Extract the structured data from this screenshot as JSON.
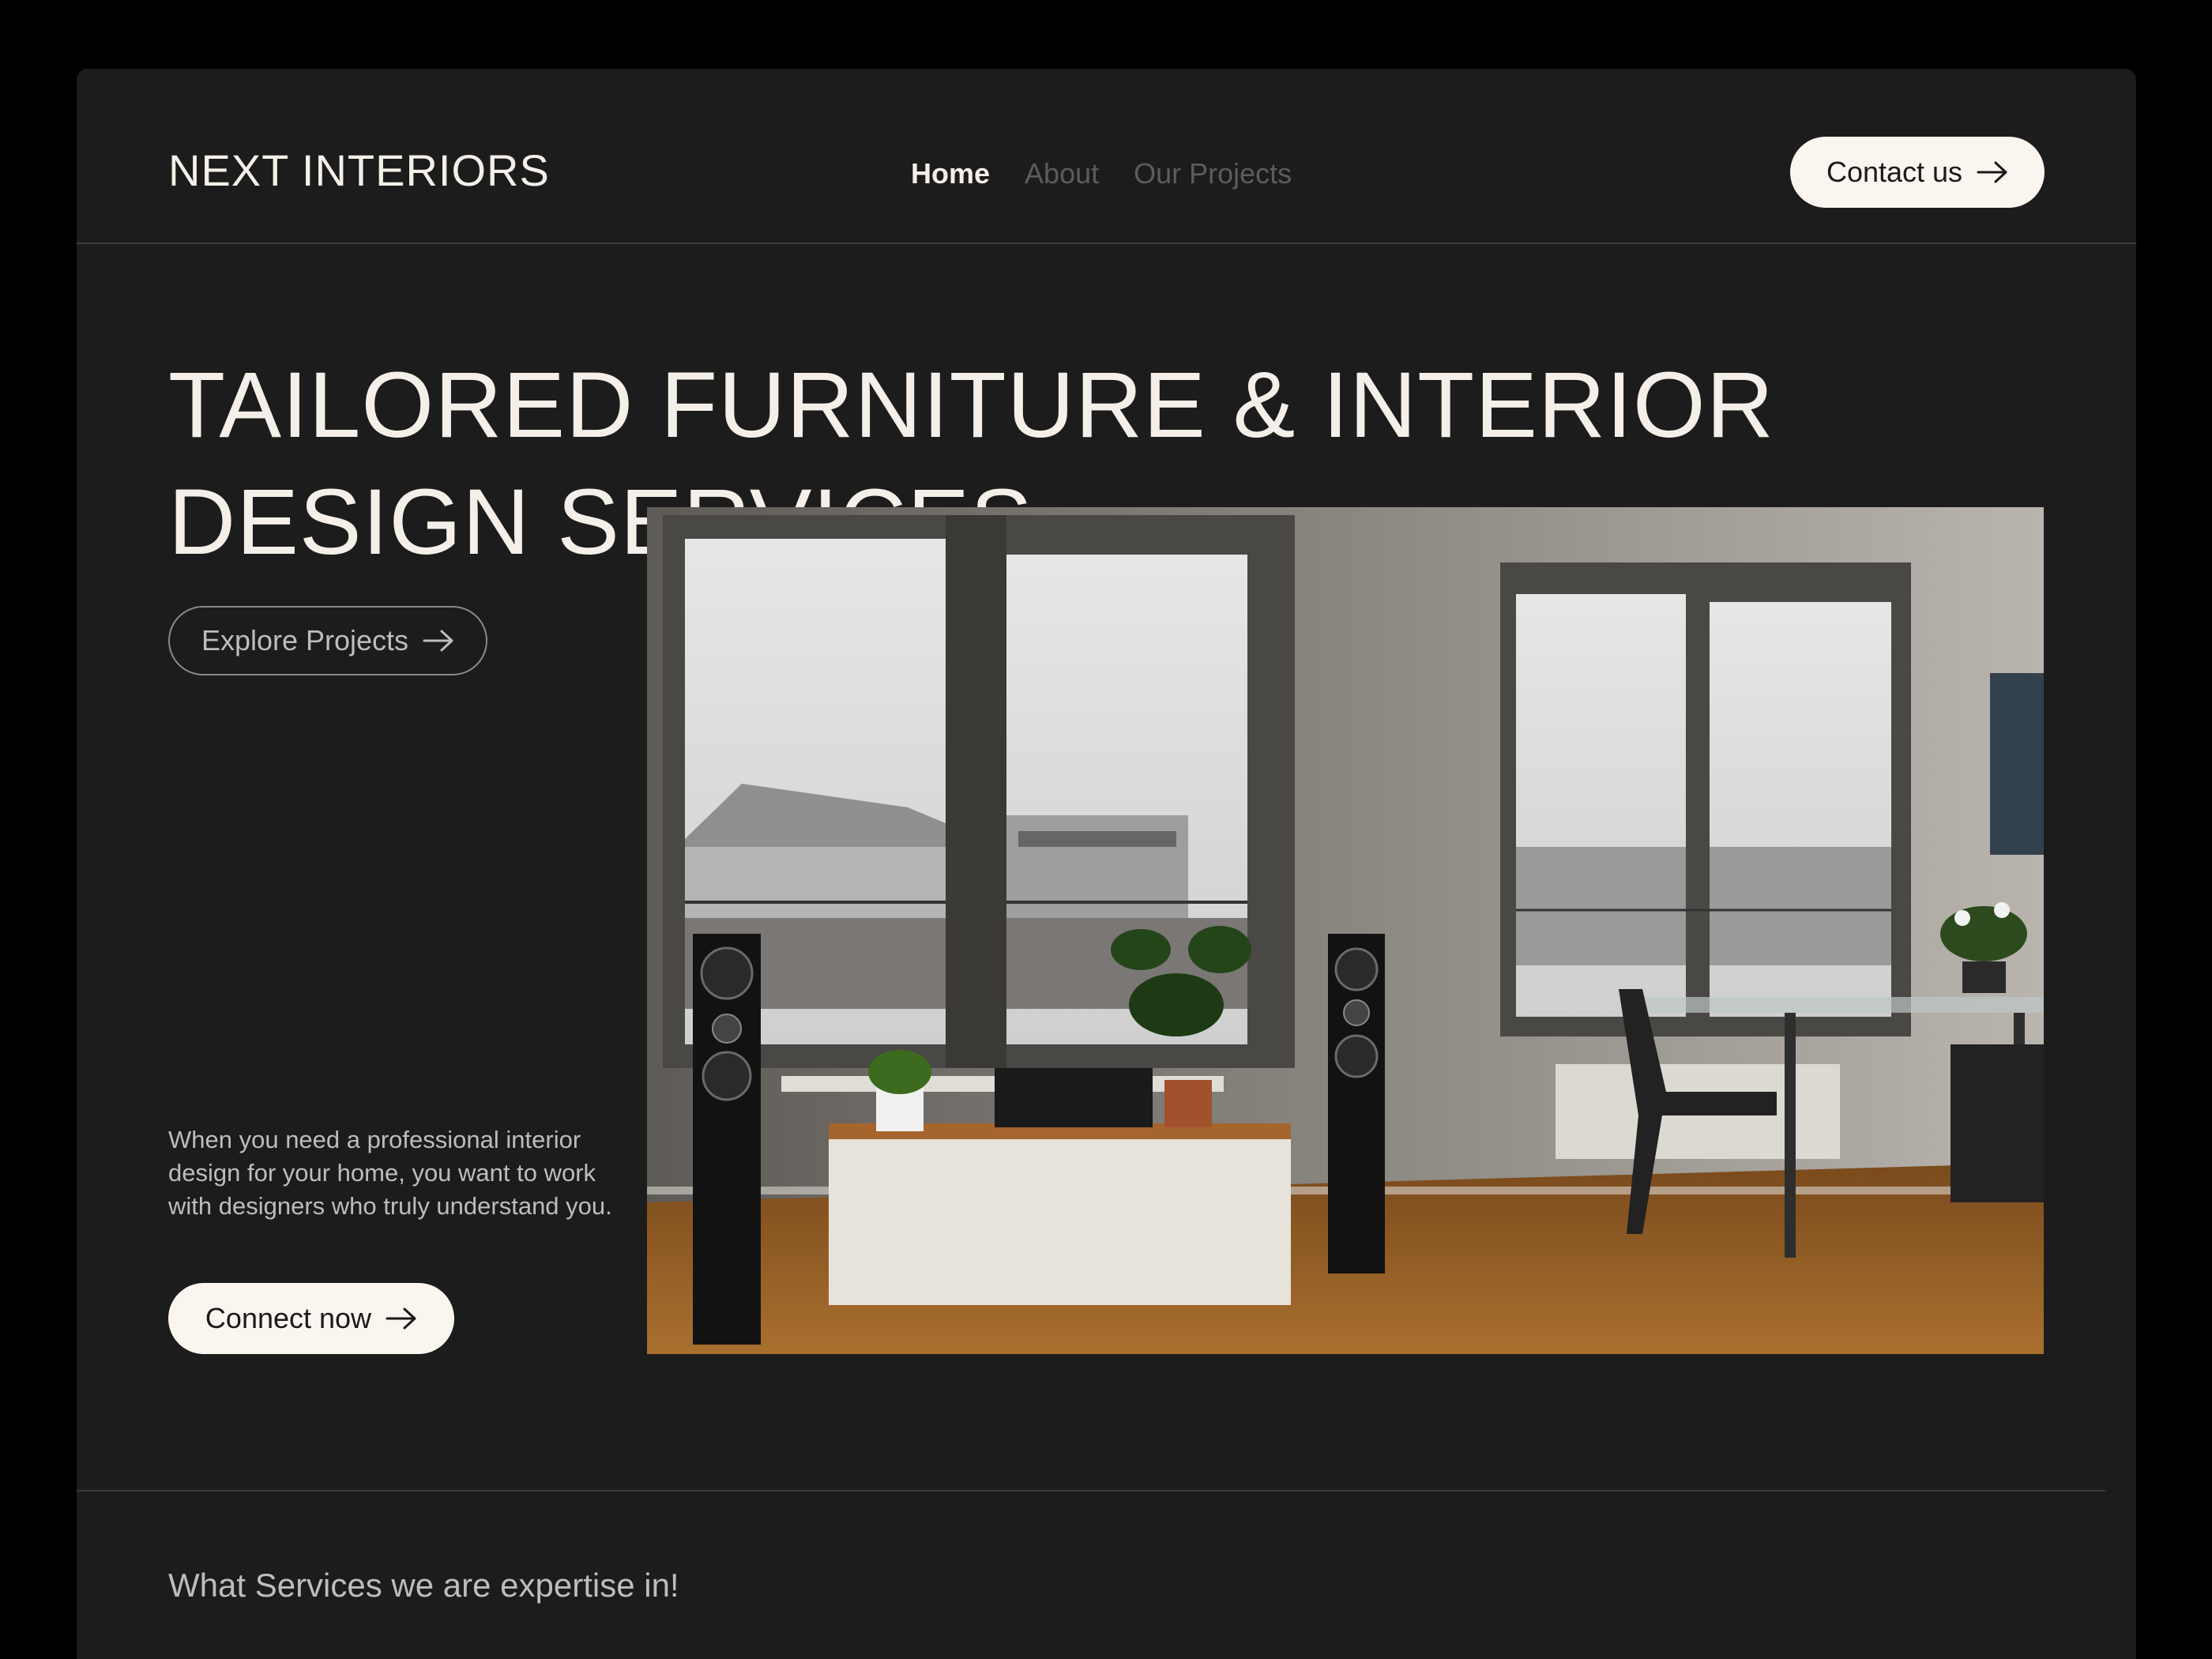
{
  "header": {
    "logo": "NEXT INTERIORS",
    "nav": [
      {
        "label": "Home",
        "active": true
      },
      {
        "label": "About",
        "active": false
      },
      {
        "label": "Our Projects",
        "active": false
      }
    ],
    "contact_label": "Contact us"
  },
  "hero": {
    "title": "TAILORED FURNITURE & INTERIOR DESIGN SERVICES",
    "explore_label": "Explore Projects",
    "description": "When you need a professional interior design for your home, you want to work with designers who truly understand you.",
    "connect_label": "Connect now"
  },
  "services": {
    "heading": "What Services we are expertise in!"
  },
  "colors": {
    "page_bg": "#000000",
    "frame_bg": "#1c1c1c",
    "text_primary": "#f4efe8",
    "text_secondary": "#bdbdbd",
    "nav_inactive": "#5c5c5c",
    "button_light": "#faf5ef"
  },
  "icons": [
    "arrow-right-icon"
  ]
}
